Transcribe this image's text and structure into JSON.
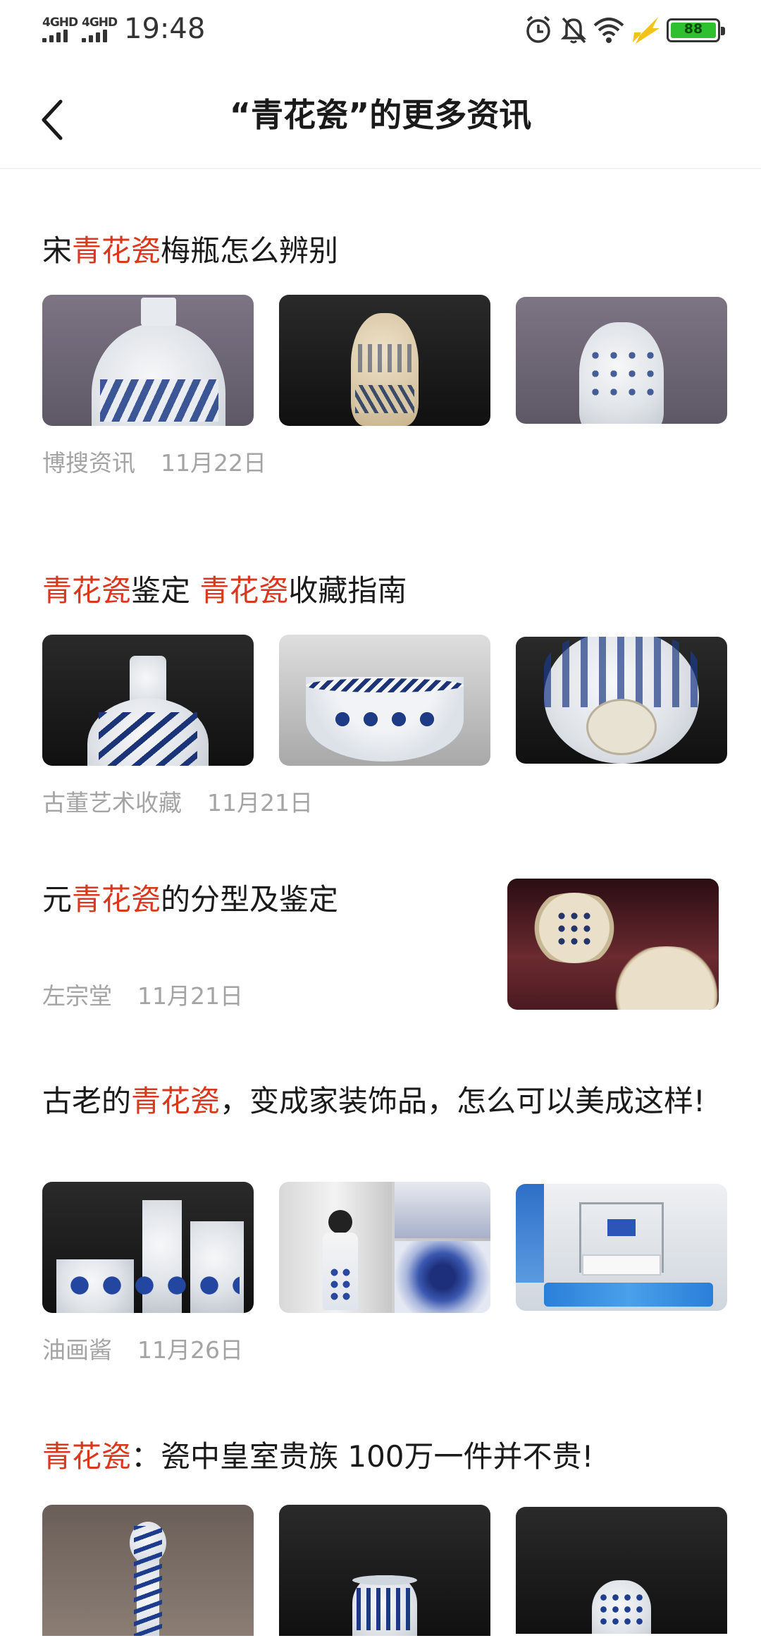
{
  "status_bar": {
    "network_1": "4GHD",
    "network_2": "4GHD",
    "time": "19:48",
    "battery": "88",
    "icons": [
      "alarm-icon",
      "bell-off-icon",
      "wifi-icon",
      "charging-icon",
      "battery-icon"
    ]
  },
  "header": {
    "back_icon": "chevron-left-icon",
    "title": "“青花瓷”的更多资讯"
  },
  "colors": {
    "highlight": "#d9381e",
    "meta_text": "#a4a4a4",
    "title_text": "#1a1a1a"
  },
  "articles": [
    {
      "title_prefix": "宋",
      "keyword": "青花瓷",
      "title_suffix": "梅瓶怎么辨别",
      "source": "博搜资讯",
      "date": "11月22日"
    },
    {
      "keyword": "青花瓷",
      "title_mid": "鉴定 ",
      "keyword_2": "青花瓷",
      "title_suffix": "收藏指南",
      "source": "古董艺术收藏",
      "date": "11月21日"
    },
    {
      "title_prefix": "元",
      "keyword": "青花瓷",
      "title_suffix": "的分型及鉴定",
      "source": "左宗堂",
      "date": "11月21日"
    },
    {
      "title_prefix": "古老的",
      "keyword": "青花瓷",
      "title_suffix": "，变成家装饰品，怎么可以美成这样!",
      "source": "油画酱",
      "date": "11月26日"
    },
    {
      "keyword": "青花瓷",
      "title_suffix": "：瓷中皇室贵族 100万一件并不贵!"
    }
  ]
}
